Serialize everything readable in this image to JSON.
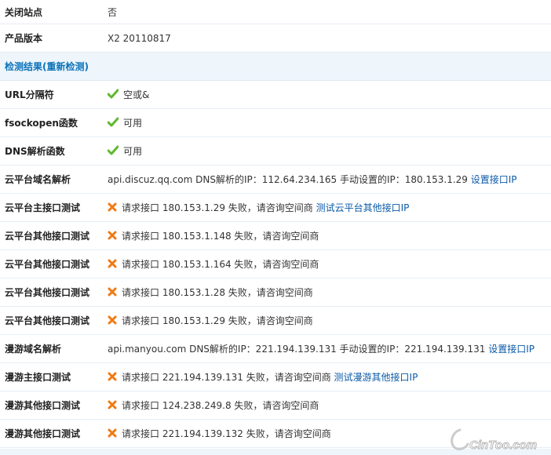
{
  "rows": [
    {
      "label": "关闭站点",
      "value": "否"
    },
    {
      "label": "产品版本",
      "value": "X2 20110817"
    }
  ],
  "section": {
    "title": "检测结果(重新检测)"
  },
  "checks": [
    {
      "label": "URL分隔符",
      "status": "ok",
      "value": "空或&"
    },
    {
      "label": "fsockopen函数",
      "status": "ok",
      "value": "可用"
    },
    {
      "label": "DNS解析函数",
      "status": "ok",
      "value": "可用"
    }
  ],
  "cloud_dns": {
    "label": "云平台域名解析",
    "text": "api.discuz.qq.com DNS解析的IP：112.64.234.165 手动设置的IP：180.153.1.29",
    "link": "设置接口IP"
  },
  "cloud_main": {
    "label": "云平台主接口测试",
    "text": "请求接口  180.153.1.29 失败，请咨询空间商",
    "link": "测试云平台其他接口IP"
  },
  "cloud_others": [
    {
      "label": "云平台其他接口测试",
      "text": "请求接口  180.153.1.148 失败，请咨询空间商"
    },
    {
      "label": "云平台其他接口测试",
      "text": "请求接口  180.153.1.164 失败，请咨询空间商"
    },
    {
      "label": "云平台其他接口测试",
      "text": "请求接口  180.153.1.28 失败，请咨询空间商"
    },
    {
      "label": "云平台其他接口测试",
      "text": "请求接口  180.153.1.29 失败，请咨询空间商"
    }
  ],
  "manyou_dns": {
    "label": "漫游域名解析",
    "text": "api.manyou.com DNS解析的IP：221.194.139.131 手动设置的IP：221.194.139.131",
    "link": "设置接口IP"
  },
  "manyou_main": {
    "label": "漫游主接口测试",
    "text": "请求接口  221.194.139.131 失败，请咨询空间商",
    "link": "测试漫游其他接口IP"
  },
  "manyou_others": [
    {
      "label": "漫游其他接口测试",
      "text": "请求接口  124.238.249.8 失败，请咨询空间商"
    },
    {
      "label": "漫游其他接口测试",
      "text": "请求接口  221.194.139.132 失败，请咨询空间商"
    }
  ],
  "colors": {
    "ok": "#5fb82e",
    "fail": "#f07a12",
    "link": "#0a5aa8",
    "section": "#0b73b9"
  },
  "icons": {
    "ok": "check-icon",
    "fail": "cross-icon"
  },
  "watermark": "CinToo.com"
}
